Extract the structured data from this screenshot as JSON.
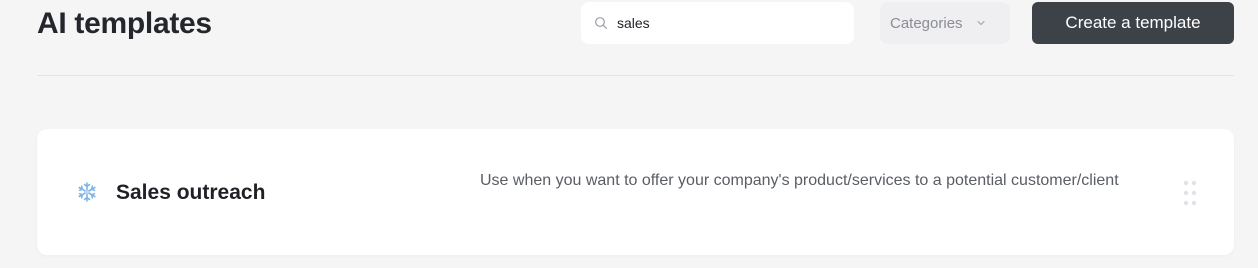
{
  "header": {
    "title": "AI templates"
  },
  "search": {
    "value": "sales",
    "icon": "search-icon"
  },
  "categories": {
    "label": "Categories",
    "icon": "chevron-down-icon"
  },
  "actions": {
    "create_label": "Create a template"
  },
  "templates": [
    {
      "icon": "snowflake-icon",
      "title": "Sales outreach",
      "description": "Use when you want to offer your company's product/services to a potential customer/client"
    }
  ],
  "colors": {
    "background": "#f5f5f6",
    "primary_button": "#3d4249",
    "icon_accent": "#7fb3e8"
  }
}
